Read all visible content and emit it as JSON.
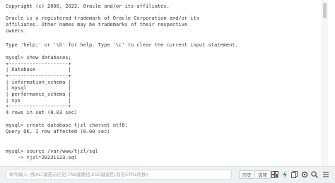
{
  "terminal": {
    "lines": [
      "Copyright (c) 2000, 2023, Oracle and/or its affiliates.",
      "",
      "Oracle is a registered trademark of Oracle Corporation and/or its",
      "affiliates. Other names may be trademarks of their respective",
      "owners.",
      "",
      "Type 'help;' or '\\h' for help. Type '\\c' to clear the current input statement.",
      "",
      "mysql> show databases;",
      "+--------------------+",
      "| Database           |",
      "+--------------------+",
      "| information_schema |",
      "| mysql              |",
      "| performance_schema |",
      "| sys                |",
      "+--------------------+",
      "4 rows in set (0.03 sec)",
      "",
      "mysql> create database tjzl charset utf8;",
      "Query OK, 1 row affected (0.00 sec)",
      "",
      "mysql> source /var/www/tjzl/sql",
      "    -> tjzl*20231123.sql"
    ]
  },
  "statusbar": {
    "input_placeholder": "命令输入 (按ALT键提示历史,TAB键路径,ESC键返回,双击CTRL切换)",
    "history_label": "历史",
    "options_label": "选项",
    "icons": [
      "grid-icon",
      "lightning-icon",
      "copy-icon",
      "settings-icon",
      "search-icon",
      "menu-icon"
    ]
  }
}
